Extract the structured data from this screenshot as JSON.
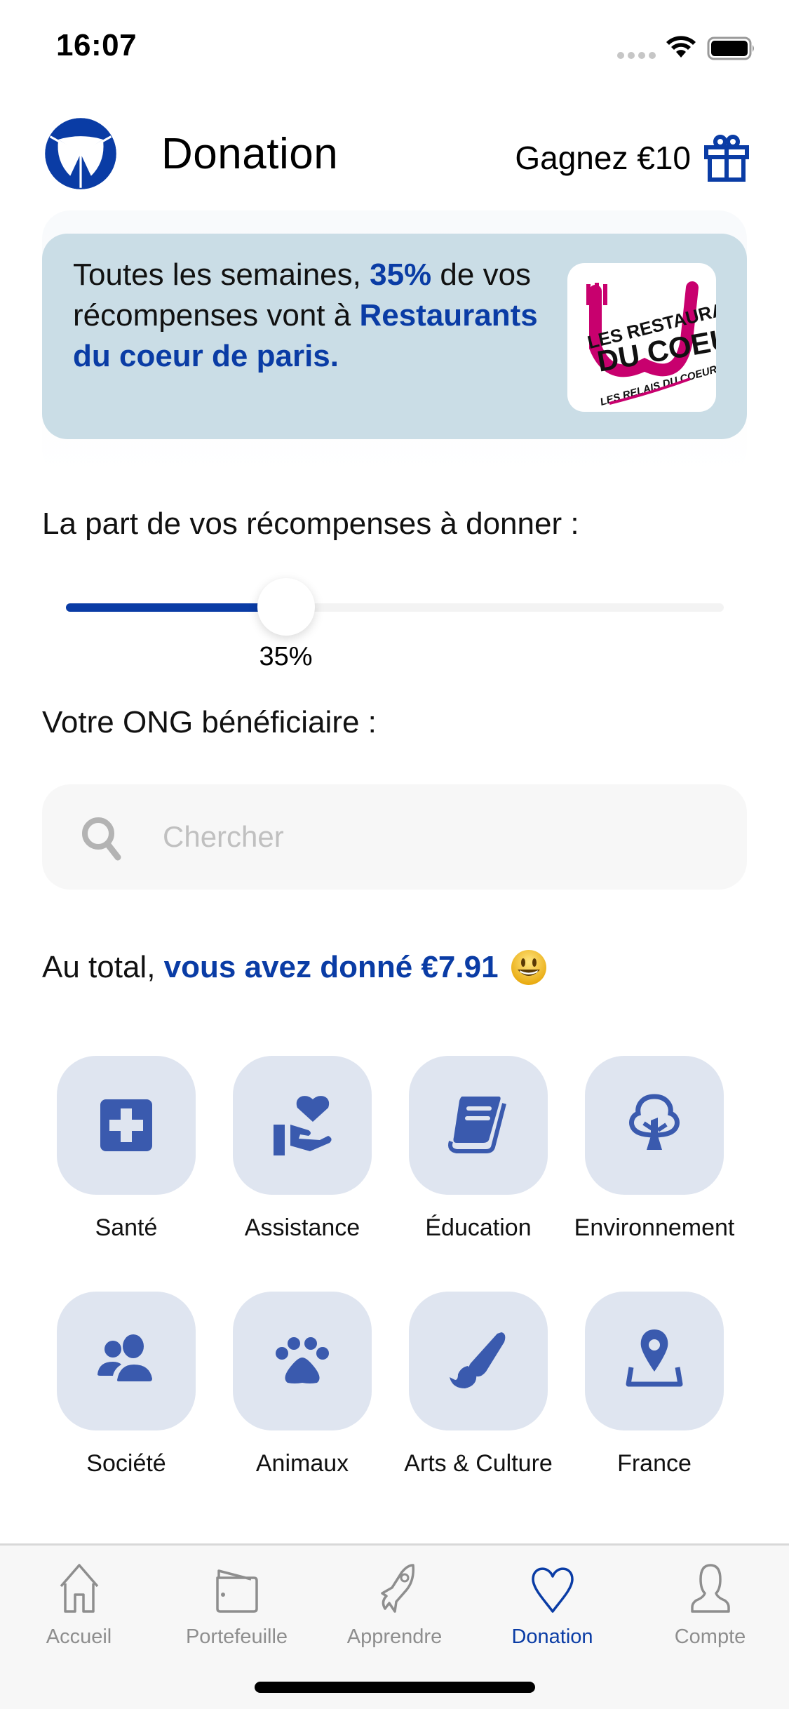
{
  "status_bar": {
    "time": "16:07",
    "icons": [
      "signal-dots-icon",
      "wifi-icon",
      "battery-icon"
    ]
  },
  "header": {
    "logo": "app-logo-icon",
    "title": "Donation",
    "earn_label": "Gagnez €10",
    "earn_icon": "gift-icon"
  },
  "banner": {
    "text_before": "Toutes les semaines, ",
    "percent": "35%",
    "text_middle": " de vos récompenses vont à ",
    "ngo_name": "Restaurants du coeur de paris.",
    "ngo_logo_lines": [
      "LES RESTAURANTS",
      "DU COEUR",
      "LES RELAIS DU COEUR"
    ],
    "ngo_logo_color": "#c8006e"
  },
  "share": {
    "label": "La part de vos récompenses à donner :",
    "value_percent": 35,
    "value_label": "35%"
  },
  "ngo_section": {
    "label": "Votre ONG bénéficiaire :",
    "search_placeholder": "Chercher",
    "search_value": ""
  },
  "total": {
    "prefix": "Au total, ",
    "highlight": "vous avez donné €7.91",
    "emoji": "smiley-emoji"
  },
  "categories": [
    {
      "label": "Santé",
      "icon": "medical-cross-icon"
    },
    {
      "label": "Assistance",
      "icon": "hand-heart-icon"
    },
    {
      "label": "Éducation",
      "icon": "book-icon"
    },
    {
      "label": "Environnement",
      "icon": "tree-icon"
    },
    {
      "label": "Société",
      "icon": "people-icon"
    },
    {
      "label": "Animaux",
      "icon": "paw-icon"
    },
    {
      "label": "Arts & Culture",
      "icon": "paintbrush-icon"
    },
    {
      "label": "France",
      "icon": "map-pin-icon"
    }
  ],
  "tabbar": {
    "active": "Donation",
    "tabs": [
      {
        "label": "Accueil",
        "icon": "home-icon"
      },
      {
        "label": "Portefeuille",
        "icon": "wallet-icon"
      },
      {
        "label": "Apprendre",
        "icon": "rocket-icon"
      },
      {
        "label": "Donation",
        "icon": "heart-icon"
      },
      {
        "label": "Compte",
        "icon": "user-icon"
      }
    ]
  },
  "colors": {
    "brand_blue": "#0a3ca5",
    "icon_blue": "#3a5aae",
    "banner_bg": "#cadde6",
    "tile_bg": "#dfe5f0",
    "inactive_gray": "#8e8e8e"
  }
}
